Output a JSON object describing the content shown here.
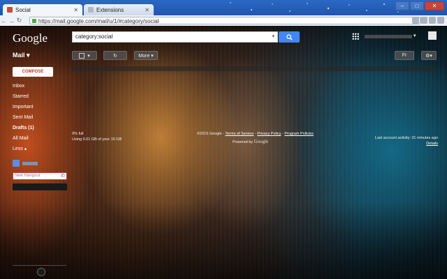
{
  "browser": {
    "tabs": [
      {
        "title": "Social"
      },
      {
        "title": "Extensions"
      }
    ],
    "url": "https://mail.google.com/mail/u/1/#category/social",
    "window_buttons": [
      "–",
      "□",
      "✕"
    ]
  },
  "header": {
    "logo": "Google",
    "search_value": "category:social"
  },
  "gmail": {
    "mail_label": "Mail ▾",
    "compose_label": "COMPOSE",
    "more_label": "More ▾",
    "lang_label": "Fr",
    "nav": [
      {
        "label": "Inbox"
      },
      {
        "label": "Starred"
      },
      {
        "label": "Important"
      },
      {
        "label": "Sent Mail"
      },
      {
        "label": "Drafts (1)"
      },
      {
        "label": "All Mail"
      },
      {
        "label": "Less ▴"
      }
    ],
    "hangout_placeholder": "New Hangout"
  },
  "footer": {
    "storage_percent": "0% full",
    "storage_detail": "Using 0.01 GB of your 15 GB",
    "copyright": "©2015 Google -",
    "terms": "Terms of Service",
    "privacy": "Privacy Policy",
    "program": "Program Policies",
    "powered_by": "Powered by",
    "google": "Google",
    "activity": "Last account activity: 31 minutes ago",
    "details": "Details"
  },
  "colors": {
    "accent_blue": "#4286f5",
    "compose_red": "#c43a2e"
  }
}
